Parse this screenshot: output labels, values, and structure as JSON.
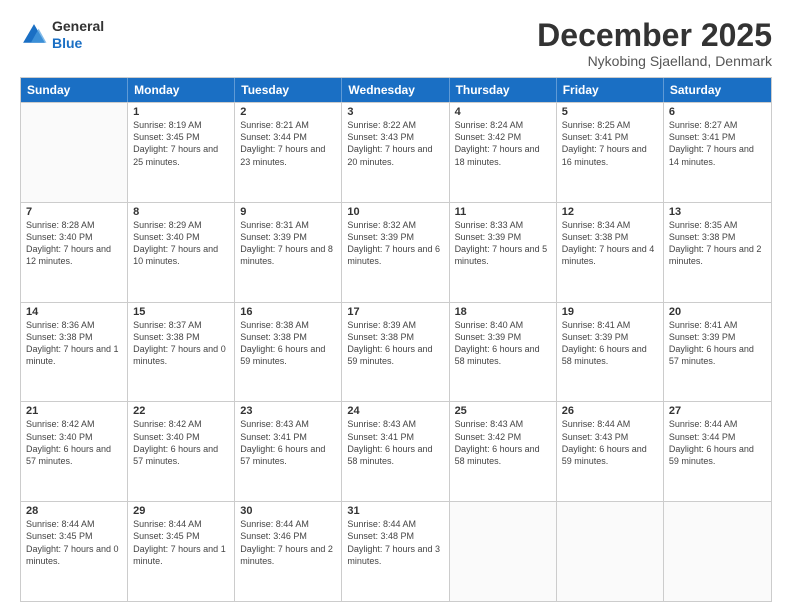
{
  "header": {
    "logo": {
      "general": "General",
      "blue": "Blue"
    },
    "title": "December 2025",
    "location": "Nykobing Sjaelland, Denmark"
  },
  "days": [
    "Sunday",
    "Monday",
    "Tuesday",
    "Wednesday",
    "Thursday",
    "Friday",
    "Saturday"
  ],
  "weeks": [
    [
      {
        "date": "",
        "sunrise": "",
        "sunset": "",
        "daylight": ""
      },
      {
        "date": "1",
        "sunrise": "Sunrise: 8:19 AM",
        "sunset": "Sunset: 3:45 PM",
        "daylight": "Daylight: 7 hours and 25 minutes."
      },
      {
        "date": "2",
        "sunrise": "Sunrise: 8:21 AM",
        "sunset": "Sunset: 3:44 PM",
        "daylight": "Daylight: 7 hours and 23 minutes."
      },
      {
        "date": "3",
        "sunrise": "Sunrise: 8:22 AM",
        "sunset": "Sunset: 3:43 PM",
        "daylight": "Daylight: 7 hours and 20 minutes."
      },
      {
        "date": "4",
        "sunrise": "Sunrise: 8:24 AM",
        "sunset": "Sunset: 3:42 PM",
        "daylight": "Daylight: 7 hours and 18 minutes."
      },
      {
        "date": "5",
        "sunrise": "Sunrise: 8:25 AM",
        "sunset": "Sunset: 3:41 PM",
        "daylight": "Daylight: 7 hours and 16 minutes."
      },
      {
        "date": "6",
        "sunrise": "Sunrise: 8:27 AM",
        "sunset": "Sunset: 3:41 PM",
        "daylight": "Daylight: 7 hours and 14 minutes."
      }
    ],
    [
      {
        "date": "7",
        "sunrise": "Sunrise: 8:28 AM",
        "sunset": "Sunset: 3:40 PM",
        "daylight": "Daylight: 7 hours and 12 minutes."
      },
      {
        "date": "8",
        "sunrise": "Sunrise: 8:29 AM",
        "sunset": "Sunset: 3:40 PM",
        "daylight": "Daylight: 7 hours and 10 minutes."
      },
      {
        "date": "9",
        "sunrise": "Sunrise: 8:31 AM",
        "sunset": "Sunset: 3:39 PM",
        "daylight": "Daylight: 7 hours and 8 minutes."
      },
      {
        "date": "10",
        "sunrise": "Sunrise: 8:32 AM",
        "sunset": "Sunset: 3:39 PM",
        "daylight": "Daylight: 7 hours and 6 minutes."
      },
      {
        "date": "11",
        "sunrise": "Sunrise: 8:33 AM",
        "sunset": "Sunset: 3:39 PM",
        "daylight": "Daylight: 7 hours and 5 minutes."
      },
      {
        "date": "12",
        "sunrise": "Sunrise: 8:34 AM",
        "sunset": "Sunset: 3:38 PM",
        "daylight": "Daylight: 7 hours and 4 minutes."
      },
      {
        "date": "13",
        "sunrise": "Sunrise: 8:35 AM",
        "sunset": "Sunset: 3:38 PM",
        "daylight": "Daylight: 7 hours and 2 minutes."
      }
    ],
    [
      {
        "date": "14",
        "sunrise": "Sunrise: 8:36 AM",
        "sunset": "Sunset: 3:38 PM",
        "daylight": "Daylight: 7 hours and 1 minute."
      },
      {
        "date": "15",
        "sunrise": "Sunrise: 8:37 AM",
        "sunset": "Sunset: 3:38 PM",
        "daylight": "Daylight: 7 hours and 0 minutes."
      },
      {
        "date": "16",
        "sunrise": "Sunrise: 8:38 AM",
        "sunset": "Sunset: 3:38 PM",
        "daylight": "Daylight: 6 hours and 59 minutes."
      },
      {
        "date": "17",
        "sunrise": "Sunrise: 8:39 AM",
        "sunset": "Sunset: 3:38 PM",
        "daylight": "Daylight: 6 hours and 59 minutes."
      },
      {
        "date": "18",
        "sunrise": "Sunrise: 8:40 AM",
        "sunset": "Sunset: 3:39 PM",
        "daylight": "Daylight: 6 hours and 58 minutes."
      },
      {
        "date": "19",
        "sunrise": "Sunrise: 8:41 AM",
        "sunset": "Sunset: 3:39 PM",
        "daylight": "Daylight: 6 hours and 58 minutes."
      },
      {
        "date": "20",
        "sunrise": "Sunrise: 8:41 AM",
        "sunset": "Sunset: 3:39 PM",
        "daylight": "Daylight: 6 hours and 57 minutes."
      }
    ],
    [
      {
        "date": "21",
        "sunrise": "Sunrise: 8:42 AM",
        "sunset": "Sunset: 3:40 PM",
        "daylight": "Daylight: 6 hours and 57 minutes."
      },
      {
        "date": "22",
        "sunrise": "Sunrise: 8:42 AM",
        "sunset": "Sunset: 3:40 PM",
        "daylight": "Daylight: 6 hours and 57 minutes."
      },
      {
        "date": "23",
        "sunrise": "Sunrise: 8:43 AM",
        "sunset": "Sunset: 3:41 PM",
        "daylight": "Daylight: 6 hours and 57 minutes."
      },
      {
        "date": "24",
        "sunrise": "Sunrise: 8:43 AM",
        "sunset": "Sunset: 3:41 PM",
        "daylight": "Daylight: 6 hours and 58 minutes."
      },
      {
        "date": "25",
        "sunrise": "Sunrise: 8:43 AM",
        "sunset": "Sunset: 3:42 PM",
        "daylight": "Daylight: 6 hours and 58 minutes."
      },
      {
        "date": "26",
        "sunrise": "Sunrise: 8:44 AM",
        "sunset": "Sunset: 3:43 PM",
        "daylight": "Daylight: 6 hours and 59 minutes."
      },
      {
        "date": "27",
        "sunrise": "Sunrise: 8:44 AM",
        "sunset": "Sunset: 3:44 PM",
        "daylight": "Daylight: 6 hours and 59 minutes."
      }
    ],
    [
      {
        "date": "28",
        "sunrise": "Sunrise: 8:44 AM",
        "sunset": "Sunset: 3:45 PM",
        "daylight": "Daylight: 7 hours and 0 minutes."
      },
      {
        "date": "29",
        "sunrise": "Sunrise: 8:44 AM",
        "sunset": "Sunset: 3:45 PM",
        "daylight": "Daylight: 7 hours and 1 minute."
      },
      {
        "date": "30",
        "sunrise": "Sunrise: 8:44 AM",
        "sunset": "Sunset: 3:46 PM",
        "daylight": "Daylight: 7 hours and 2 minutes."
      },
      {
        "date": "31",
        "sunrise": "Sunrise: 8:44 AM",
        "sunset": "Sunset: 3:48 PM",
        "daylight": "Daylight: 7 hours and 3 minutes."
      },
      {
        "date": "",
        "sunrise": "",
        "sunset": "",
        "daylight": ""
      },
      {
        "date": "",
        "sunrise": "",
        "sunset": "",
        "daylight": ""
      },
      {
        "date": "",
        "sunrise": "",
        "sunset": "",
        "daylight": ""
      }
    ]
  ]
}
